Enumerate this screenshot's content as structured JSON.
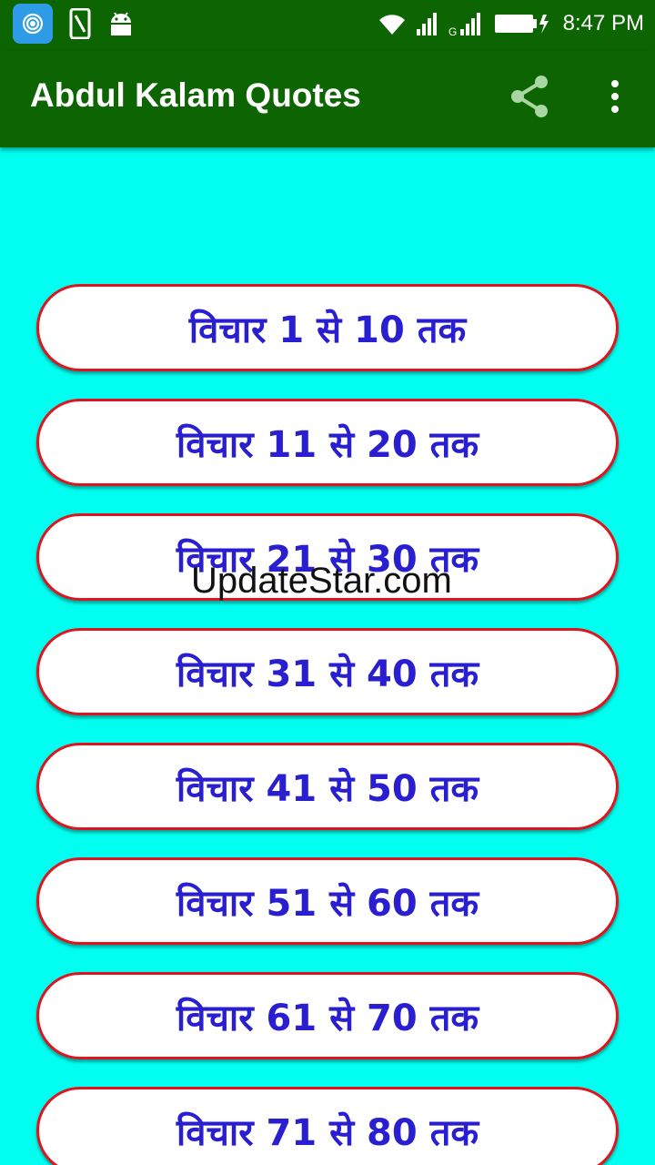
{
  "status_bar": {
    "time": "8:47 PM",
    "icons": [
      "hotspot-app-icon",
      "phone-icon",
      "android-icon",
      "wifi-icon",
      "signal-icon",
      "signal-g-icon",
      "battery-icon"
    ]
  },
  "app_bar": {
    "title": "Abdul Kalam Quotes",
    "actions": [
      "share-icon",
      "more-vert-icon"
    ]
  },
  "colors": {
    "app_bar": "#0C6500",
    "background": "#00FFF0",
    "button_border": "#E0141E",
    "button_text": "#2A1FD0"
  },
  "buttons": [
    {
      "label": "विचार 1 से 10 तक"
    },
    {
      "label": "विचार 11 से 20 तक"
    },
    {
      "label": "विचार 21 से 30 तक"
    },
    {
      "label": "विचार 31 से 40 तक"
    },
    {
      "label": "विचार 41 से 50 तक"
    },
    {
      "label": "विचार 51 से 60 तक"
    },
    {
      "label": "विचार 61 से 70 तक"
    },
    {
      "label": "विचार 71 से 80 तक"
    }
  ],
  "watermark": "UpdateStar.com"
}
